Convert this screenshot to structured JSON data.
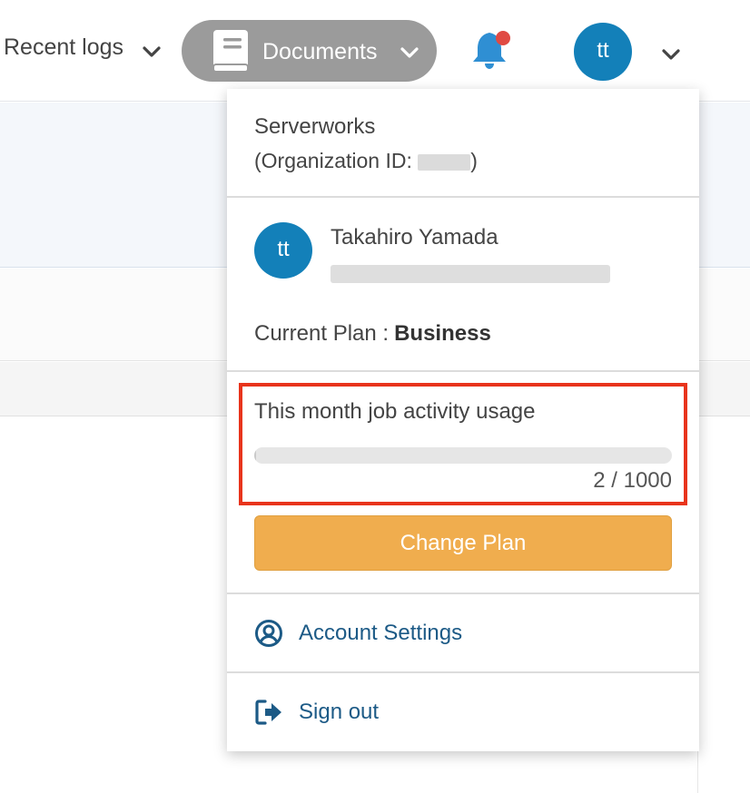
{
  "topbar": {
    "recent_logs_label": "Recent logs",
    "documents_label": "Documents",
    "user_initials": "tt",
    "notification_dot_color": "#e04a43"
  },
  "menu": {
    "organization": {
      "name": "Serverworks",
      "id_prefix": "(Organization ID: ",
      "id_suffix": ")"
    },
    "user": {
      "initials": "tt",
      "name": "Takahiro Yamada"
    },
    "plan": {
      "label": "Current Plan :",
      "value": "Business"
    },
    "usage": {
      "title": "This month job activity usage",
      "used": 2,
      "limit": 1000,
      "count_text": "2 / 1000"
    },
    "change_plan_label": "Change Plan",
    "account_settings_label": "Account Settings",
    "sign_out_label": "Sign out"
  },
  "colors": {
    "accent_blue": "#1380b9",
    "button_orange": "#f0ad4e",
    "highlight_red": "#e8341c",
    "link_blue": "#1c5a86"
  }
}
